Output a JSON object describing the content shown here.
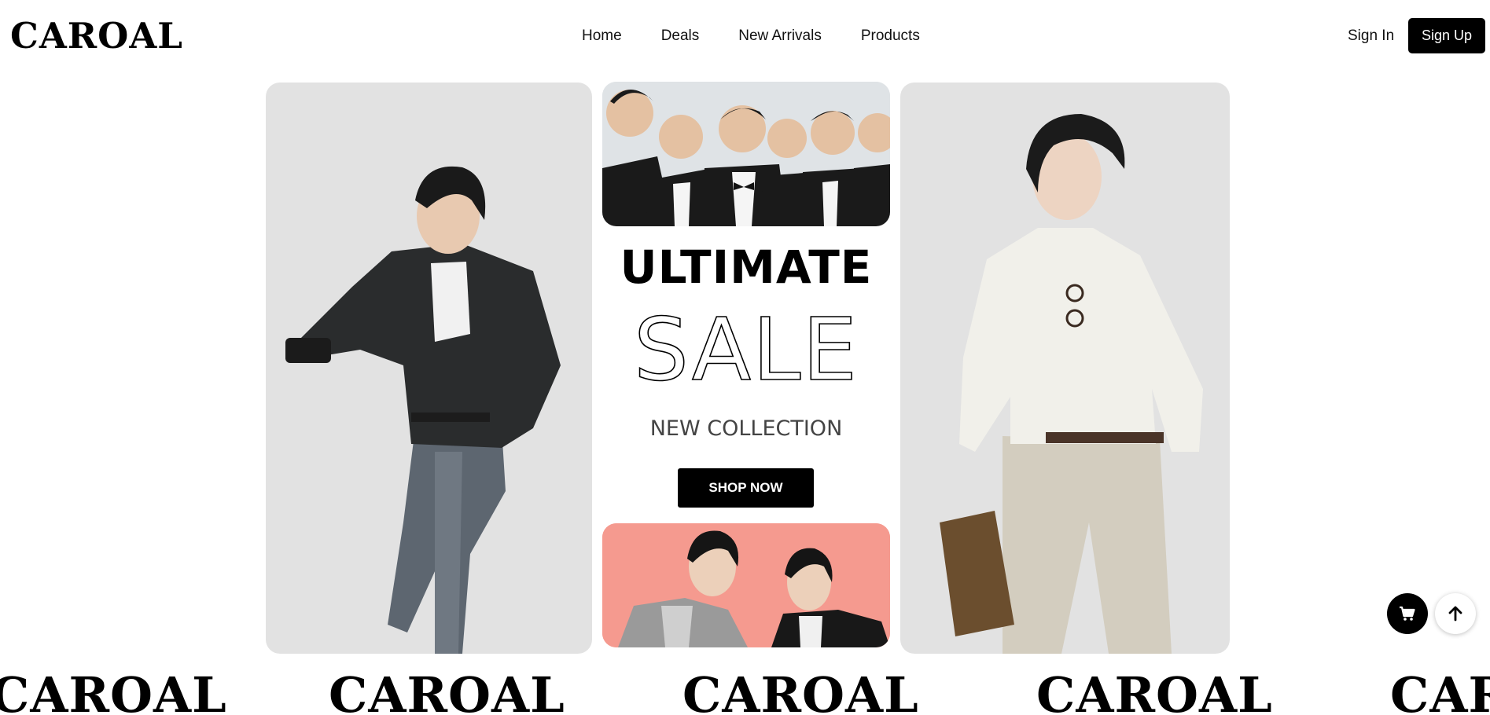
{
  "header": {
    "logo": "CAROAL",
    "nav": [
      {
        "label": "Home"
      },
      {
        "label": "Deals"
      },
      {
        "label": "New Arrivals"
      },
      {
        "label": "Products"
      }
    ],
    "sign_in": "Sign In",
    "sign_up": "Sign Up"
  },
  "hero": {
    "headline": "ULTIMATE",
    "sale": "SALE",
    "subheadline": "NEW COLLECTION",
    "cta": "SHOP NOW"
  },
  "marquee": {
    "items": [
      "CAROAL",
      "CAROAL",
      "CAROAL",
      "CAROAL",
      "CAROAL"
    ]
  },
  "icons": {
    "cart": "cart-icon",
    "scroll_top": "arrow-up-icon"
  },
  "colors": {
    "primary": "#000000",
    "card_bg": "#e2e2e2",
    "promo_bg": "#f59a8f"
  }
}
